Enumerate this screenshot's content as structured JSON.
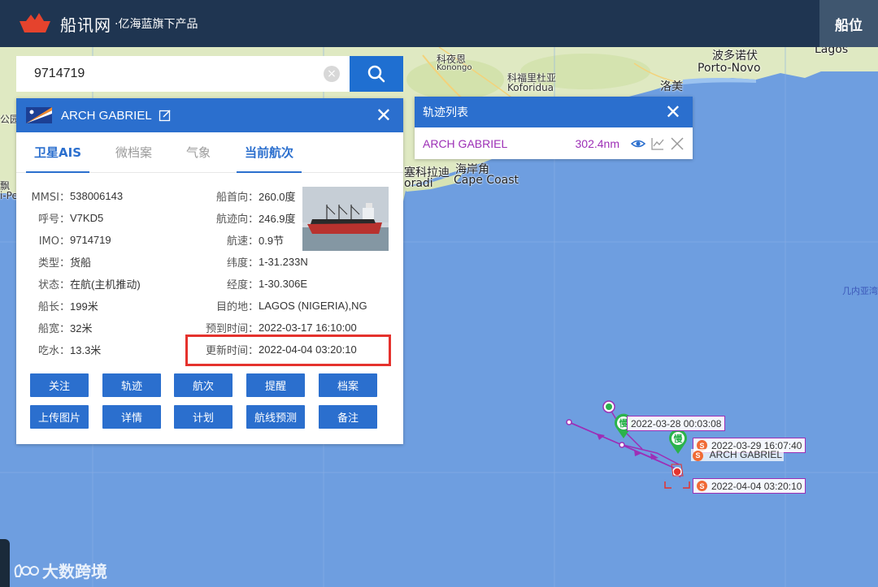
{
  "header": {
    "brand": "船讯网",
    "sub_brand": "·亿海蓝旗下产品",
    "position_button": "船位"
  },
  "search": {
    "value": "9714719",
    "placeholder": "",
    "clear_icon": "clear-icon",
    "search_icon": "search-icon"
  },
  "map": {
    "labels": {
      "kekeng_cn": "科夜恩",
      "kekeng_en": "Konongo",
      "koforidua_cn": "科福里杜亚",
      "koforidua_en": "Koforidua",
      "porto_novo_cn": "波多诺伏",
      "porto_novo_en": "Porto-Novo",
      "lagos_en": "Lagos",
      "lome_cn": "洛美",
      "cape_coast_cn": "海岸角",
      "cape_coast_en": "Cape Coast",
      "sekondi_cn": "塞科拉迪",
      "sekondi_en": "oradi",
      "gulf_label": "几内亚湾",
      "left_1": "公园",
      "left_2": "飘",
      "left_3": "i-Pe"
    },
    "accent_track": "#9d2fb6",
    "water": "#6e9ee0",
    "land": "#d9e5b8"
  },
  "ship": {
    "name": "ARCH GABRIEL",
    "tabs": [
      "卫星AIS",
      "微档案",
      "气象",
      "当前航次"
    ],
    "left": [
      {
        "k": "MMSI：",
        "v": "538006143"
      },
      {
        "k": "呼号：",
        "v": "V7KD5"
      },
      {
        "k": "IMO：",
        "v": "9714719"
      },
      {
        "k": "类型：",
        "v": "货船"
      },
      {
        "k": "状态：",
        "v": "在航(主机推动)"
      },
      {
        "k": "船长：",
        "v": "199米"
      },
      {
        "k": "船宽：",
        "v": "32米"
      },
      {
        "k": "吃水：",
        "v": "13.3米"
      }
    ],
    "right": [
      {
        "k": "船首向：",
        "v": "260.0度"
      },
      {
        "k": "航迹向：",
        "v": "246.9度"
      },
      {
        "k": "航速：",
        "v": "0.9节"
      },
      {
        "k": "纬度：",
        "v": "1-31.233N"
      },
      {
        "k": "经度：",
        "v": "1-30.306E"
      },
      {
        "k": "目的地：",
        "v": "LAGOS (NIGERIA),NG"
      },
      {
        "k": "预到时间：",
        "v": "2022-03-17 16:10:00"
      },
      {
        "k": "更新时间：",
        "v": "2022-04-04 03:20:10"
      }
    ],
    "actions_row1": [
      "关注",
      "轨迹",
      "航次",
      "提醒",
      "档案"
    ],
    "actions_row2": [
      "上传图片",
      "详情",
      "计划",
      "航线预测",
      "备注"
    ]
  },
  "track_list": {
    "title": "轨迹列表",
    "items": [
      {
        "name": "ARCH GABRIEL",
        "distance": "302.4nm"
      }
    ]
  },
  "track_markers": {
    "slow_label": "慢",
    "stop_label": "S",
    "time_1": "2022-03-28 00:03:08",
    "time_2": "2022-03-29 16:07:40",
    "time_3": "2022-04-04 03:20:10",
    "ship_name": "ARCH GABRIEL"
  },
  "watermark": "大数跨境"
}
